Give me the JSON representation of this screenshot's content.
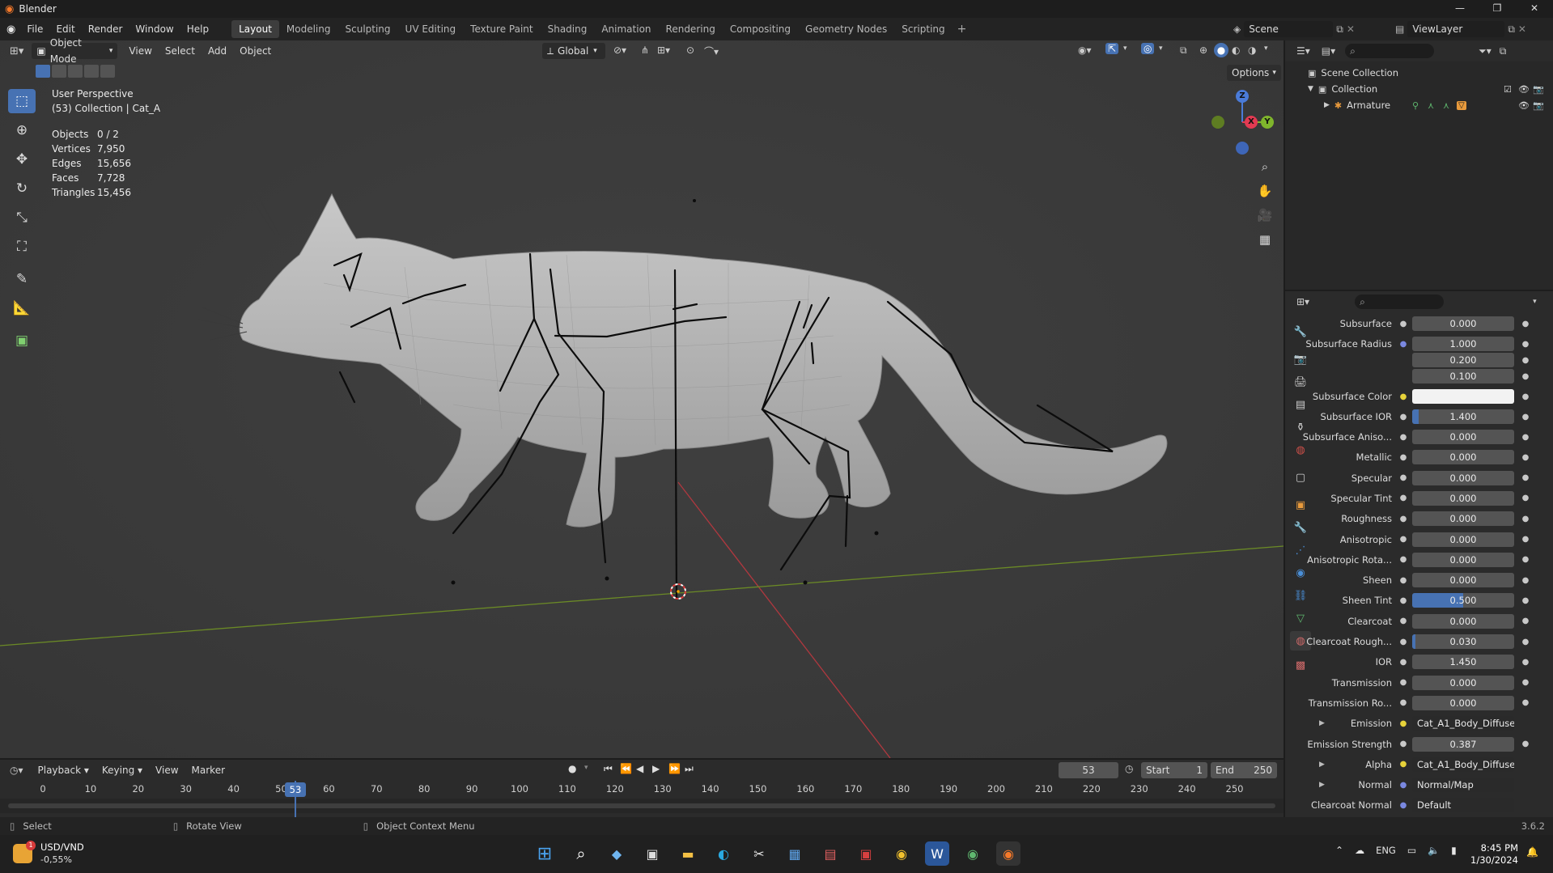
{
  "window": {
    "title": "Blender"
  },
  "menu": {
    "items": [
      "File",
      "Edit",
      "Render",
      "Window",
      "Help"
    ],
    "workspaces": [
      "Layout",
      "Modeling",
      "Sculpting",
      "UV Editing",
      "Texture Paint",
      "Shading",
      "Animation",
      "Rendering",
      "Compositing",
      "Geometry Nodes",
      "Scripting"
    ],
    "active_workspace": "Layout",
    "scene": "Scene",
    "view_layer": "ViewLayer"
  },
  "viewport_header": {
    "mode": "Object Mode",
    "menus": [
      "View",
      "Select",
      "Add",
      "Object"
    ],
    "orientation": "Global",
    "options": "Options"
  },
  "overlay_info": {
    "perspective": "User Perspective",
    "collection": "(53) Collection | Cat_A",
    "stats": [
      {
        "label": "Objects",
        "value": "0 / 2"
      },
      {
        "label": "Vertices",
        "value": "7,950"
      },
      {
        "label": "Edges",
        "value": "15,656"
      },
      {
        "label": "Faces",
        "value": "7,728"
      },
      {
        "label": "Triangles",
        "value": "15,456"
      }
    ]
  },
  "gizmo": {
    "z": "Z",
    "y": "Y",
    "x": "X"
  },
  "outliner": {
    "scene_collection": "Scene Collection",
    "collection": "Collection",
    "armature": "Armature"
  },
  "properties": {
    "rows": [
      {
        "label": "Subsurface",
        "value": "0.000",
        "fill": 0
      },
      {
        "label": "Subsurface Radius",
        "value": "1.000",
        "fill": 0
      },
      {
        "label": "",
        "value": "0.200",
        "fill": 0
      },
      {
        "label": "",
        "value": "0.100",
        "fill": 0
      },
      {
        "label": "Subsurface Color",
        "value": "",
        "fill": 0,
        "color": "#f2f2f2"
      },
      {
        "label": "Subsurface IOR",
        "value": "1.400",
        "fill": 0.06
      },
      {
        "label": "Subsurface Aniso...",
        "value": "0.000",
        "fill": 0
      },
      {
        "label": "Metallic",
        "value": "0.000",
        "fill": 0
      },
      {
        "label": "Specular",
        "value": "0.000",
        "fill": 0
      },
      {
        "label": "Specular Tint",
        "value": "0.000",
        "fill": 0
      },
      {
        "label": "Roughness",
        "value": "0.000",
        "fill": 0
      },
      {
        "label": "Anisotropic",
        "value": "0.000",
        "fill": 0
      },
      {
        "label": "Anisotropic Rota...",
        "value": "0.000",
        "fill": 0
      },
      {
        "label": "Sheen",
        "value": "0.000",
        "fill": 0
      },
      {
        "label": "Sheen Tint",
        "value": "0.500",
        "fill": 0.5
      },
      {
        "label": "Clearcoat",
        "value": "0.000",
        "fill": 0
      },
      {
        "label": "Clearcoat Rough...",
        "value": "0.030",
        "fill": 0.03
      },
      {
        "label": "IOR",
        "value": "1.450",
        "fill": 0
      },
      {
        "label": "Transmission",
        "value": "0.000",
        "fill": 0
      },
      {
        "label": "Transmission Ro...",
        "value": "0.000",
        "fill": 0
      },
      {
        "label": "Emission",
        "value": "Cat_A1_Body_Diffuse",
        "fill": 0,
        "linked": true
      },
      {
        "label": "Emission Strength",
        "value": "0.387",
        "fill": 0
      },
      {
        "label": "Alpha",
        "value": "Cat_A1_Body_Diffuse...",
        "fill": 0,
        "linked": true
      },
      {
        "label": "Normal",
        "value": "Normal/Map",
        "fill": 0,
        "linked": true
      },
      {
        "label": "Clearcoat Normal",
        "value": "Default",
        "fill": 0,
        "linked": true
      }
    ]
  },
  "timeline": {
    "menus": [
      "Playback",
      "Keying",
      "View",
      "Marker"
    ],
    "current_frame": "53",
    "start_label": "Start",
    "start": "1",
    "end_label": "End",
    "end": "250",
    "ruler": [
      "0",
      "10",
      "20",
      "30",
      "40",
      "50",
      "60",
      "70",
      "80",
      "90",
      "100",
      "110",
      "120",
      "130",
      "140",
      "150",
      "160",
      "170",
      "180",
      "190",
      "200",
      "210",
      "220",
      "230",
      "240",
      "250"
    ]
  },
  "status_bar": {
    "select": "Select",
    "rotate": "Rotate View",
    "context": "Object Context Menu",
    "version": "3.6.2"
  },
  "taskbar": {
    "ticker_name": "USD/VND",
    "ticker_change": "-0,55%",
    "lang": "ENG",
    "time": "8:45 PM",
    "date": "1/30/2024"
  }
}
